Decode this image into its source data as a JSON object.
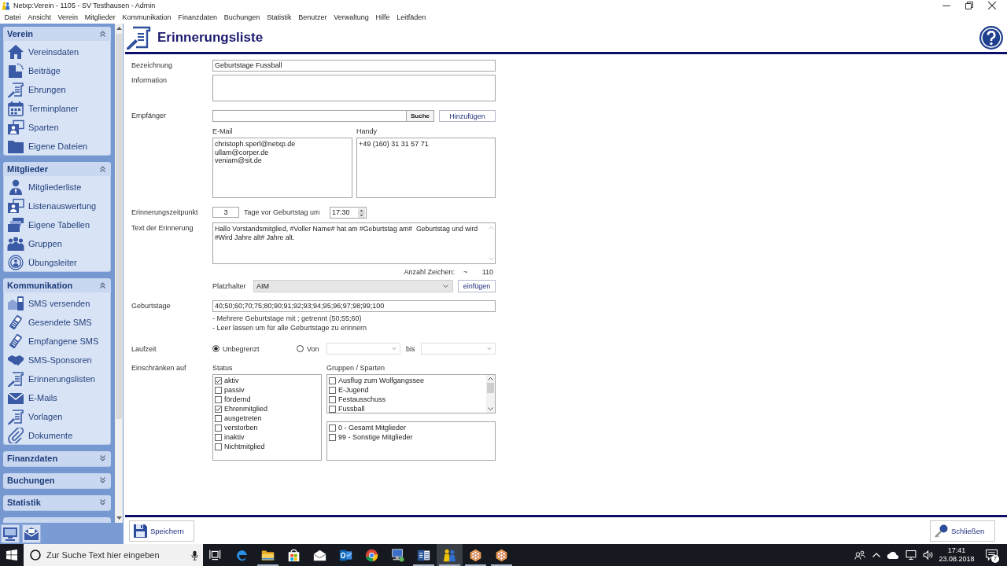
{
  "window": {
    "title": "Netxp:Verein - 1105 - SV Testhausen - Admin"
  },
  "menu": [
    "Datei",
    "Ansicht",
    "Verein",
    "Mitglieder",
    "Kommunikation",
    "Finanzdaten",
    "Buchungen",
    "Statistik",
    "Benutzer",
    "Verwaltung",
    "Hilfe",
    "Leitfäden"
  ],
  "sidebar": {
    "sections": [
      {
        "title": "Verein",
        "expanded": true,
        "items": [
          "Vereinsdaten",
          "Beiträge",
          "Ehrungen",
          "Terminplaner",
          "Sparten",
          "Eigene Dateien"
        ]
      },
      {
        "title": "Mitglieder",
        "expanded": true,
        "items": [
          "Mitgliederliste",
          "Listenauswertung",
          "Eigene Tabellen",
          "Gruppen",
          "Übungsleiter"
        ]
      },
      {
        "title": "Kommunikation",
        "expanded": true,
        "items": [
          "SMS versenden",
          "Gesendete SMS",
          "Empfangene SMS",
          "SMS-Sponsoren",
          "Erinnerungslisten",
          "E-Mails",
          "Vorlagen",
          "Dokumente"
        ]
      },
      {
        "title": "Finanzdaten",
        "expanded": false
      },
      {
        "title": "Buchungen",
        "expanded": false
      },
      {
        "title": "Statistik",
        "expanded": false
      }
    ]
  },
  "page": {
    "title": "Erinnerungsliste"
  },
  "form": {
    "name": {
      "label": "Bezeichnung",
      "value": "Geburtstage Fussball"
    },
    "information": {
      "label": "Information"
    },
    "recipient": {
      "label": "Empfänger",
      "search_button": "Suche",
      "add_button": "Hinzufügen"
    },
    "email": {
      "label": "E-Mail",
      "entries": [
        "christoph.sperl@netxp.de",
        "ullam@corper.de",
        "veniam@sit.de"
      ]
    },
    "mobile": {
      "label": "Handy",
      "entries": [
        "+49 (160) 31 31 57 71"
      ]
    },
    "reminder_time": {
      "label": "Erinnerungszeitpunkt",
      "days": "3",
      "days_text": "Tage vor Geburtstag um",
      "time": "17:30"
    },
    "reminder_text": {
      "label": "Text der Erinnerung",
      "value": "Hallo Vorstandsmitglied, #Voller Name# hat am #Geburtstag am#  Geburtstag und wird #Wird Jahre alt# Jahre alt.",
      "char_count_label": "Anzahl Zeichen:",
      "char_count_sep": "~",
      "char_count": "110"
    },
    "variable": {
      "label": "Platzhalter",
      "value": "AIM",
      "button": "einfügen"
    },
    "birthdays": {
      "label": "Geburtstage",
      "value": "40;50;60;70;75;80;90;91;92;93;94;95;96;97;98;99;100",
      "hints": [
        "- Mehrere Geburtstage mit ; getrennt (50;55;60)",
        "- Leer lassen um für alle Geburtstage zu erinnern"
      ]
    },
    "runtime": {
      "label": "Laufzeit",
      "options": [
        {
          "label": "Unbegrenzt",
          "selected": true
        },
        {
          "label": "Von",
          "selected": false
        }
      ],
      "from_date": {
        "disabled": true
      },
      "to_label": "bis",
      "to_date": {
        "disabled": true
      }
    },
    "restrict": {
      "label": "Einschränken auf",
      "status": {
        "label": "Status",
        "items": [
          {
            "label": "aktiv",
            "checked": true
          },
          {
            "label": "passiv",
            "checked": false
          },
          {
            "label": "fördernd",
            "checked": false
          },
          {
            "label": "Ehrenmitglied",
            "checked": true
          },
          {
            "label": "ausgetreten",
            "checked": false
          },
          {
            "label": "verstorben",
            "checked": false
          },
          {
            "label": "inaktiv",
            "checked": false
          },
          {
            "label": "Nichtmitglied",
            "checked": false
          }
        ]
      },
      "groups": {
        "label": "Gruppen / Sparten",
        "items": [
          {
            "label": "Ausflug zum Wolfgangssee",
            "checked": false
          },
          {
            "label": "E-Jugend",
            "checked": false
          },
          {
            "label": "Festausschuss",
            "checked": false
          },
          {
            "label": "Fussball",
            "checked": false
          }
        ]
      },
      "other_groups": {
        "items": [
          {
            "label": "0 - Gesamt Mitglieder",
            "checked": false
          },
          {
            "label": "99 - Sonstige Mitglieder",
            "checked": false
          }
        ]
      }
    }
  },
  "footer": {
    "save": "Speichern",
    "close": "Schließen"
  },
  "taskbar": {
    "search": {
      "placeholder": "Zur Suche Text hier eingeben"
    },
    "apps": [
      {
        "running": false,
        "selected": false
      },
      {
        "running": true,
        "selected": false
      },
      {
        "running": false,
        "selected": false
      },
      {
        "running": false,
        "selected": false
      },
      {
        "running": false,
        "selected": false
      },
      {
        "running": false,
        "selected": false
      },
      {
        "running": false,
        "selected": false
      },
      {
        "running": true,
        "selected": false
      },
      {
        "running": true,
        "selected": true
      },
      {
        "running": true,
        "selected": false
      },
      {
        "running": true,
        "selected": false
      }
    ],
    "clock": {
      "time": "17:41",
      "date": "23.08.2018"
    },
    "notifications": "7"
  }
}
